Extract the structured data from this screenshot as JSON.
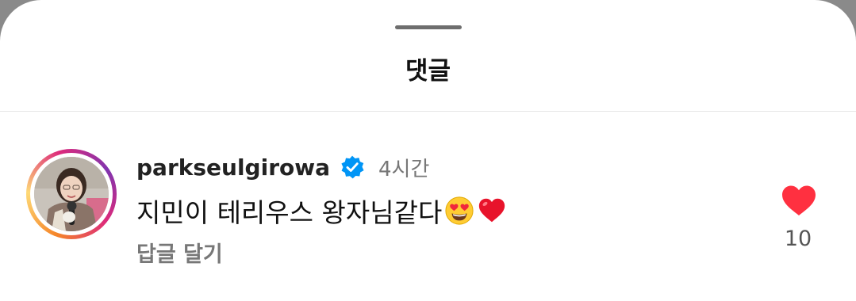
{
  "sheet": {
    "title": "댓글"
  },
  "comment": {
    "username": "parkseulgirowa",
    "verified": true,
    "time": "4시간",
    "text": "지민이 테리우스 왕자님같다",
    "emojis": [
      "heart-eyes-emoji",
      "red-heart-emoji"
    ],
    "reply_label": "답글 달기",
    "like_count": "10",
    "liked": true
  },
  "colors": {
    "like": "#ff3040",
    "verified": "#0095f6",
    "muted_text": "#777777"
  }
}
